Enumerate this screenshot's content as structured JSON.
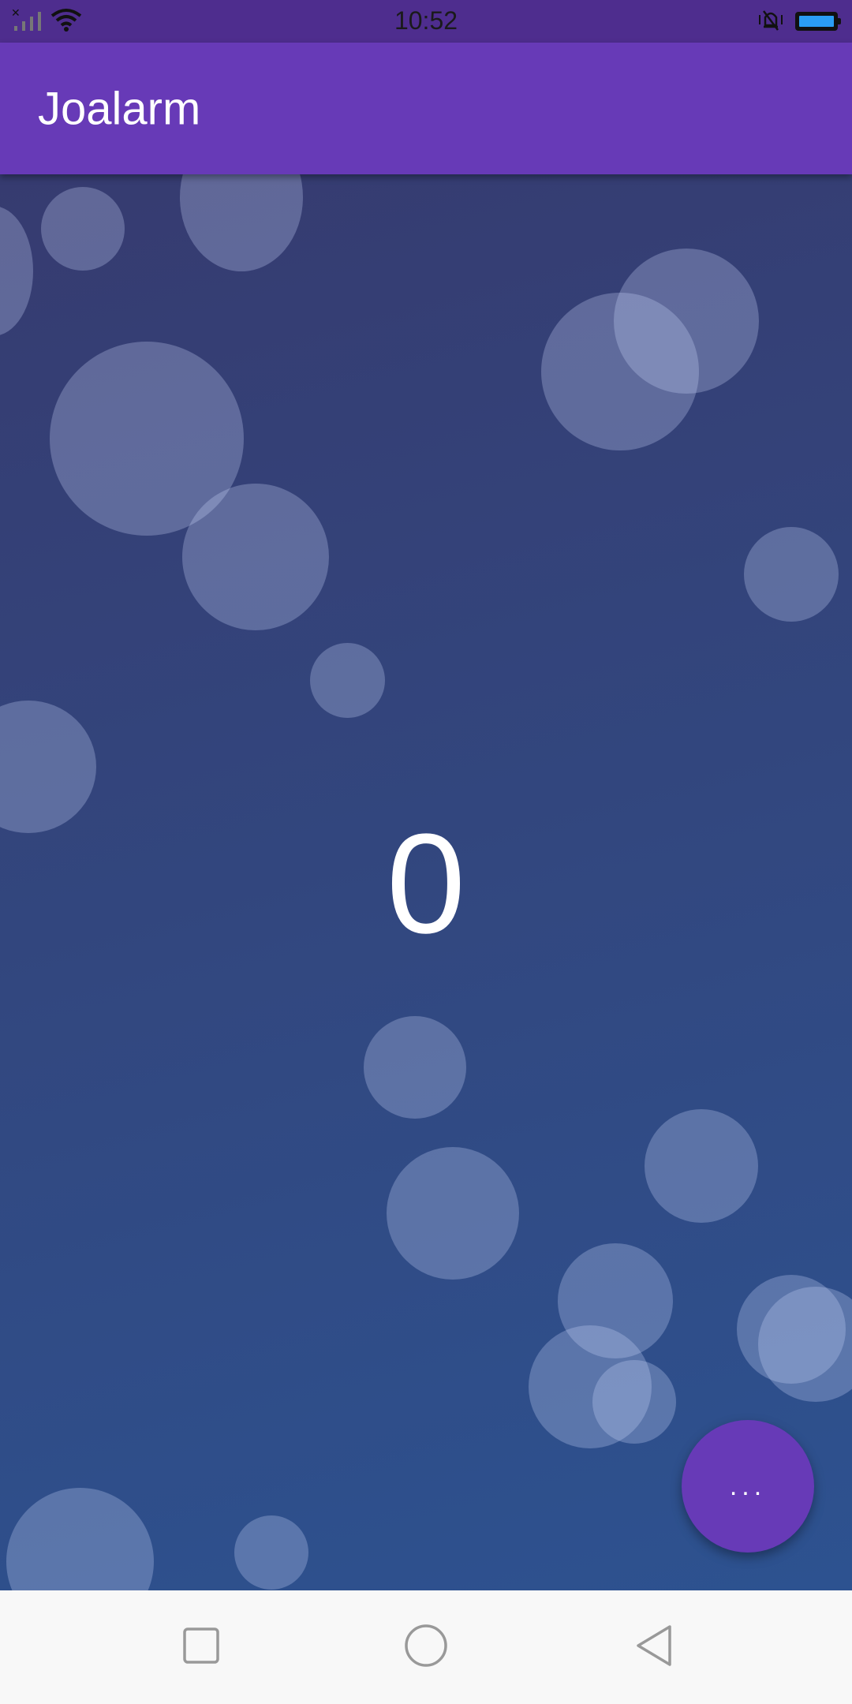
{
  "status_bar": {
    "time": "10:52",
    "icons": [
      "no-signal-icon",
      "wifi-icon",
      "vibrate-silent-icon",
      "battery-icon"
    ],
    "battery_color": "#2a9df4"
  },
  "app_bar": {
    "title": "Joalarm",
    "color": "#673ab7"
  },
  "main": {
    "counter": "0",
    "background_colors": [
      "#363b70",
      "#2d5290"
    ]
  },
  "fab": {
    "label": "...",
    "color": "#673ab7"
  },
  "nav_bar": {
    "buttons": [
      "recent-apps-icon",
      "home-icon",
      "back-icon"
    ]
  }
}
